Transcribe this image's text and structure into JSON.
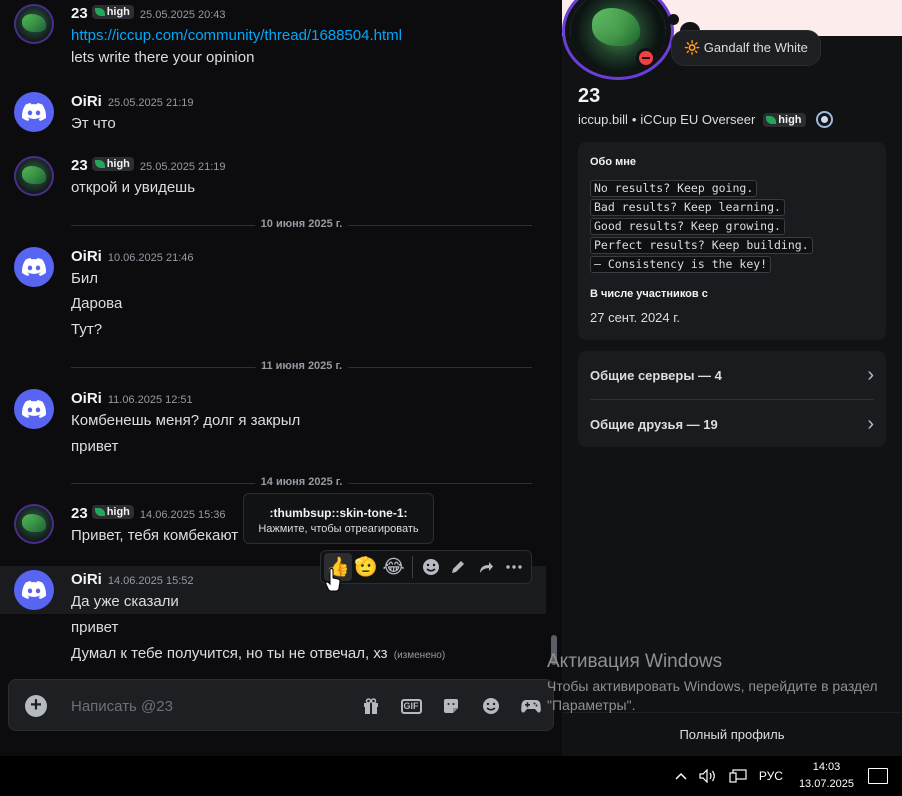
{
  "chat": {
    "messages": [
      {
        "user": "23",
        "badge": "high",
        "time": "25.05.2025 20:43",
        "lines": [
          "https://iccup.com/community/thread/1688504.html",
          "lets write there your opinion"
        ]
      },
      {
        "user": "OiRi",
        "time": "25.05.2025 21:19",
        "lines": [
          "Эт что"
        ]
      },
      {
        "user": "23",
        "badge": "high",
        "time": "25.05.2025 21:19",
        "lines": [
          "открой и увидешь"
        ]
      },
      {
        "user": "OiRi",
        "time": "10.06.2025 21:46",
        "lines": [
          "Бил",
          "Дарова",
          "Тут?"
        ]
      },
      {
        "user": "OiRi",
        "time": "11.06.2025 12:51",
        "lines": [
          "Комбенешь меня? долг я закрыл",
          "привет"
        ]
      },
      {
        "user": "23",
        "badge": "high",
        "time": "14.06.2025 15:36",
        "lines": [
          "Привет, тебя комбекают"
        ]
      },
      {
        "user": "OiRi",
        "time": "14.06.2025 15:52",
        "lines": [
          "Да уже сказали",
          "привет",
          "Думал к тебе получится, но ты не отвечал, хз"
        ],
        "edited": "(изменено)"
      }
    ],
    "dividers": [
      "10 июня 2025 г.",
      "11 июня 2025 г.",
      "14 июня 2025 г."
    ],
    "tooltip": {
      "title": ":thumbsup::skin-tone-1:",
      "hint": "Нажмите, чтобы отреагировать"
    },
    "toolbar_reactions": [
      "👍",
      "🫡",
      "😂"
    ],
    "composer": {
      "placeholder": "Написать @23"
    }
  },
  "profile": {
    "status": "🔆 Gandalf the White",
    "display_name": "23",
    "username": "iccup.bill",
    "separator": "•",
    "tagline": "iCCup EU Overseer",
    "badge": "high",
    "about_title": "Обо мне",
    "about_lines": [
      "No results? Keep going.",
      "Bad results? Keep learning.",
      "Good results? Keep growing.",
      "Perfect results? Keep building.",
      "— Consistency is the key!"
    ],
    "member_since_title": "В числе участников с",
    "member_since": "27 сент. 2024 г.",
    "mutual_servers": "Общие серверы — 4",
    "mutual_friends": "Общие друзья — 19",
    "full_profile": "Полный профиль"
  },
  "activation": {
    "title": "Активация Windows",
    "text": "Чтобы активировать Windows, перейдите в раздел \"Параметры\"."
  },
  "taskbar": {
    "lang": "РУС",
    "time": "14:03",
    "date": "13.07.2025"
  },
  "colors": {
    "link": "#00a8fc",
    "badge_leaf": "#23a55a",
    "dnd": "#f23f43",
    "discord_blurple": "#5865f2"
  }
}
